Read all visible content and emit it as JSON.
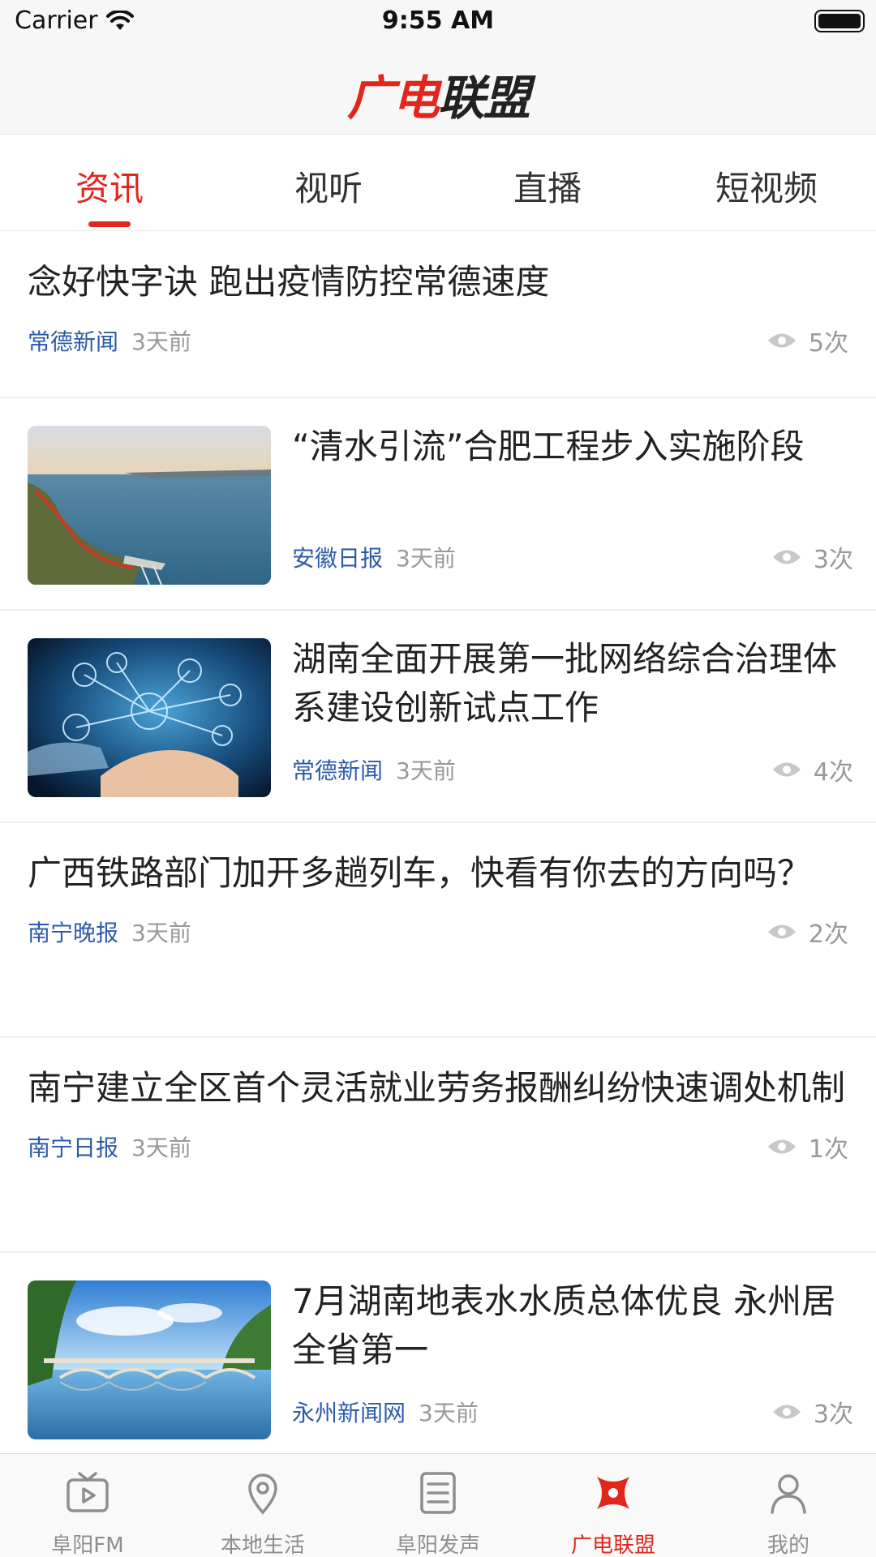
{
  "status_bar": {
    "carrier": "Carrier",
    "time": "9:55 AM"
  },
  "header": {
    "logo_part1": "广电",
    "logo_part2": "联盟"
  },
  "tabs": [
    {
      "label": "资讯",
      "active": true
    },
    {
      "label": "视听",
      "active": false
    },
    {
      "label": "直播",
      "active": false
    },
    {
      "label": "短视频",
      "active": false
    }
  ],
  "feed": [
    {
      "title": "念好快字诀 跑出疫情防控常德速度",
      "source": "常德新闻",
      "time": "3天前",
      "views": "5次",
      "image": "none"
    },
    {
      "title": "“清水引流”合肥工程步入实施阶段",
      "source": "安徽日报",
      "time": "3天前",
      "views": "3次",
      "image": "lake-aerial-photo"
    },
    {
      "title": "湖南全面开展第一批网络综合治理体系建设创新试点工作",
      "source": "常德新闻",
      "time": "3天前",
      "views": "4次",
      "image": "network-hand-photo"
    },
    {
      "title": "广西铁路部门加开多趟列车，快看有你去的方向吗？",
      "source": "南宁晚报",
      "time": "3天前",
      "views": "2次",
      "image": "none"
    },
    {
      "title": "南宁建立全区首个灵活就业劳务报酬纠纷快速调处机制",
      "source": "南宁日报",
      "time": "3天前",
      "views": "1次",
      "image": "none"
    },
    {
      "title": "7月湖南地表水水质总体优良 永州居全省第一",
      "source": "永州新闻网",
      "time": "3天前",
      "views": "3次",
      "image": "river-bridge-photo"
    }
  ],
  "tab_bar": [
    {
      "label": "阜阳FM",
      "icon": "tv-play-icon",
      "active": false
    },
    {
      "label": "本地生活",
      "icon": "location-pin-icon",
      "active": false
    },
    {
      "label": "阜阳发声",
      "icon": "document-list-icon",
      "active": false
    },
    {
      "label": "广电联盟",
      "icon": "alliance-logo-icon",
      "active": true
    },
    {
      "label": "我的",
      "icon": "person-icon",
      "active": false
    }
  ],
  "colors": {
    "accent": "#e2261c",
    "source_link": "#2d5ba8",
    "muted": "#999999"
  }
}
